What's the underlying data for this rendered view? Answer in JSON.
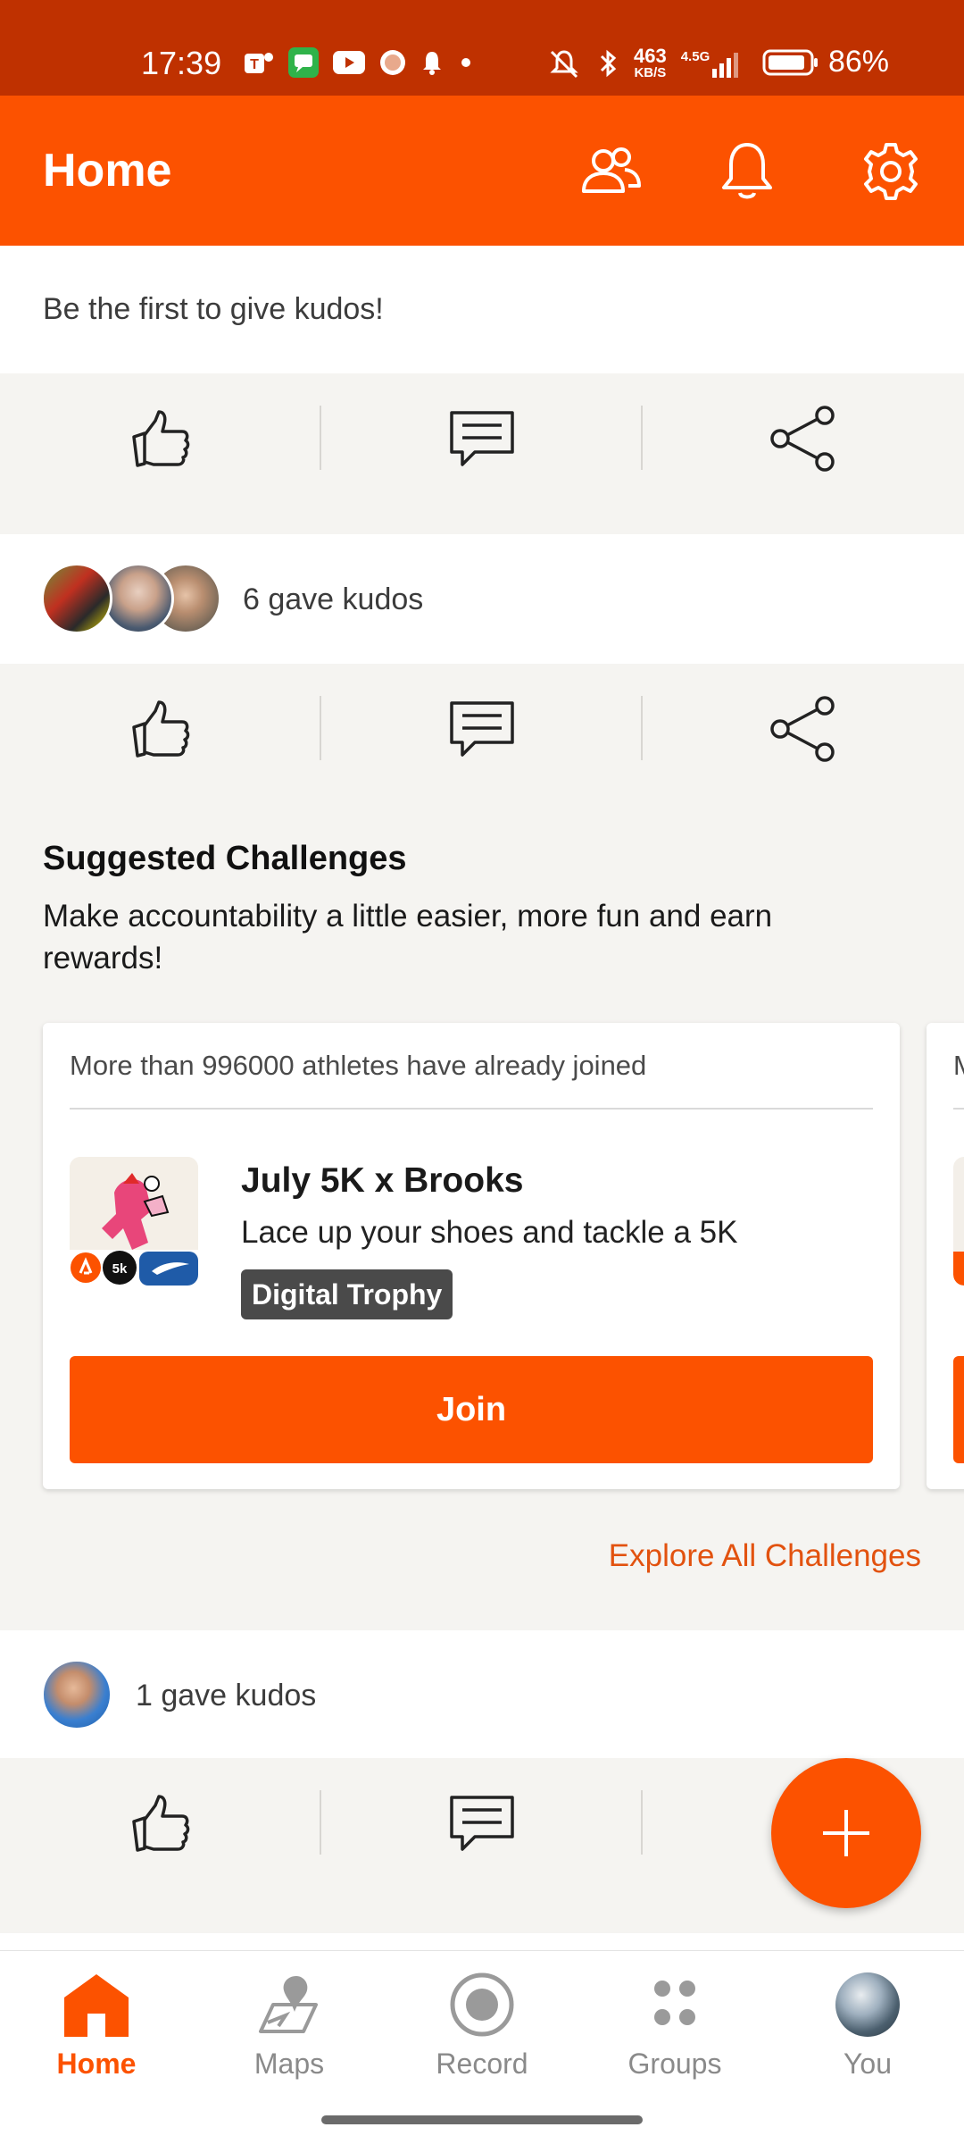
{
  "status_bar": {
    "time": "17:39",
    "net_speed_top": "463",
    "net_speed_bottom": "KB/S",
    "signal_label": "4.5G",
    "battery": "86%"
  },
  "header": {
    "title": "Home",
    "icons": [
      "people-icon",
      "bell-icon",
      "gear-icon"
    ]
  },
  "feed": {
    "post1": {
      "kudos_text": "Be the first to give kudos!"
    },
    "post2": {
      "kudos_text": "6 gave kudos"
    },
    "post3": {
      "kudos_text": "1 gave kudos"
    }
  },
  "challenges": {
    "title": "Suggested Challenges",
    "subtitle": "Make accountability a little easier, more fun and earn rewards!",
    "card": {
      "joined_text": "More than 996000 athletes have already joined",
      "name": "July 5K x Brooks",
      "description": "Lace up your shoes and tackle a 5K",
      "badge": "Digital Trophy",
      "join_label": "Join",
      "thumb_badge": "5k"
    },
    "peek_letter": "M",
    "explore_label": "Explore All Challenges"
  },
  "bottom_nav": {
    "items": [
      {
        "label": "Home",
        "active": true
      },
      {
        "label": "Maps",
        "active": false
      },
      {
        "label": "Record",
        "active": false
      },
      {
        "label": "Groups",
        "active": false
      },
      {
        "label": "You",
        "active": false
      }
    ]
  },
  "colors": {
    "brand": "#fc5200",
    "status_bar": "#bf3100",
    "link": "#e2520f"
  }
}
